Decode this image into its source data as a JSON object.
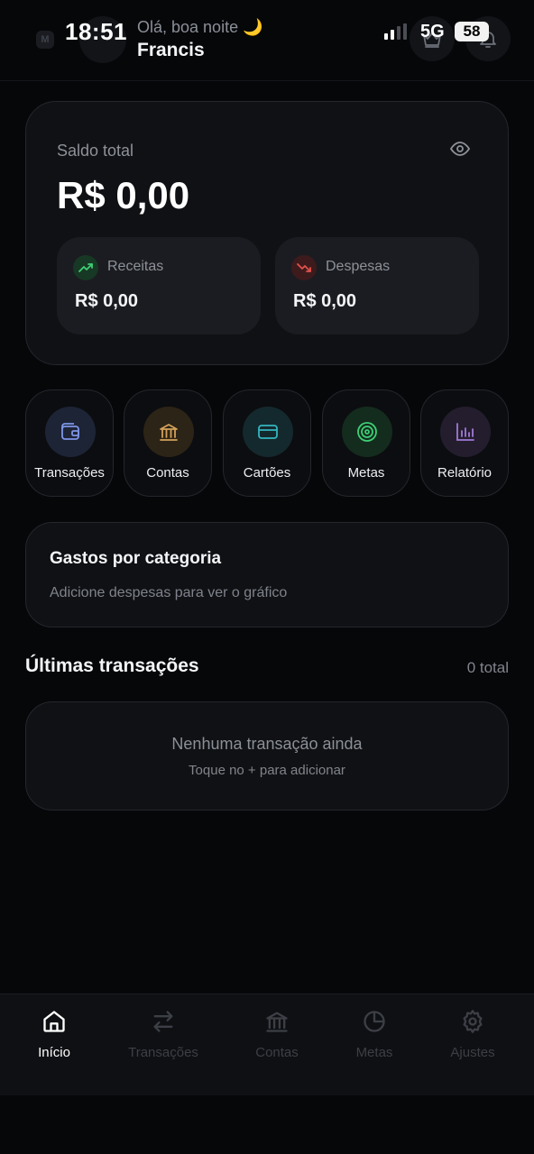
{
  "status_bar": {
    "time": "18:51",
    "network": "5G",
    "battery": "58"
  },
  "header": {
    "logo_letter": "M",
    "greeting": "Olá, boa noite 🌙",
    "user_name": "Francis"
  },
  "balance": {
    "label": "Saldo total",
    "value": "R$ 0,00",
    "income": {
      "label": "Receitas",
      "value": "R$ 0,00",
      "color": "#3ecf75"
    },
    "expense": {
      "label": "Despesas",
      "value": "R$ 0,00",
      "color": "#e0524c"
    }
  },
  "quick_actions": [
    {
      "label": "Transações",
      "icon": "wallet-icon",
      "color": "#7f95e8"
    },
    {
      "label": "Contas",
      "icon": "bank-icon",
      "color": "#d3a15a"
    },
    {
      "label": "Cartões",
      "icon": "card-icon",
      "color": "#34b5c0"
    },
    {
      "label": "Metas",
      "icon": "target-icon",
      "color": "#3ecf75"
    },
    {
      "label": "Relatório",
      "icon": "chart-icon",
      "color": "#a07ad6"
    }
  ],
  "category_card": {
    "title": "Gastos por categoria",
    "subtitle": "Adicione despesas para ver o gráfico"
  },
  "transactions": {
    "title": "Últimas transações",
    "count": "0 total",
    "empty_title": "Nenhuma transação ainda",
    "empty_subtitle": "Toque no + para adicionar"
  },
  "bottom_nav": [
    {
      "label": "Início",
      "icon": "home-icon",
      "active": true
    },
    {
      "label": "Transações",
      "icon": "transfer-icon",
      "active": false
    },
    {
      "label": "Contas",
      "icon": "bank-icon",
      "active": false
    },
    {
      "label": "Metas",
      "icon": "pie-icon",
      "active": false
    },
    {
      "label": "Ajustes",
      "icon": "gear-icon",
      "active": false
    }
  ]
}
